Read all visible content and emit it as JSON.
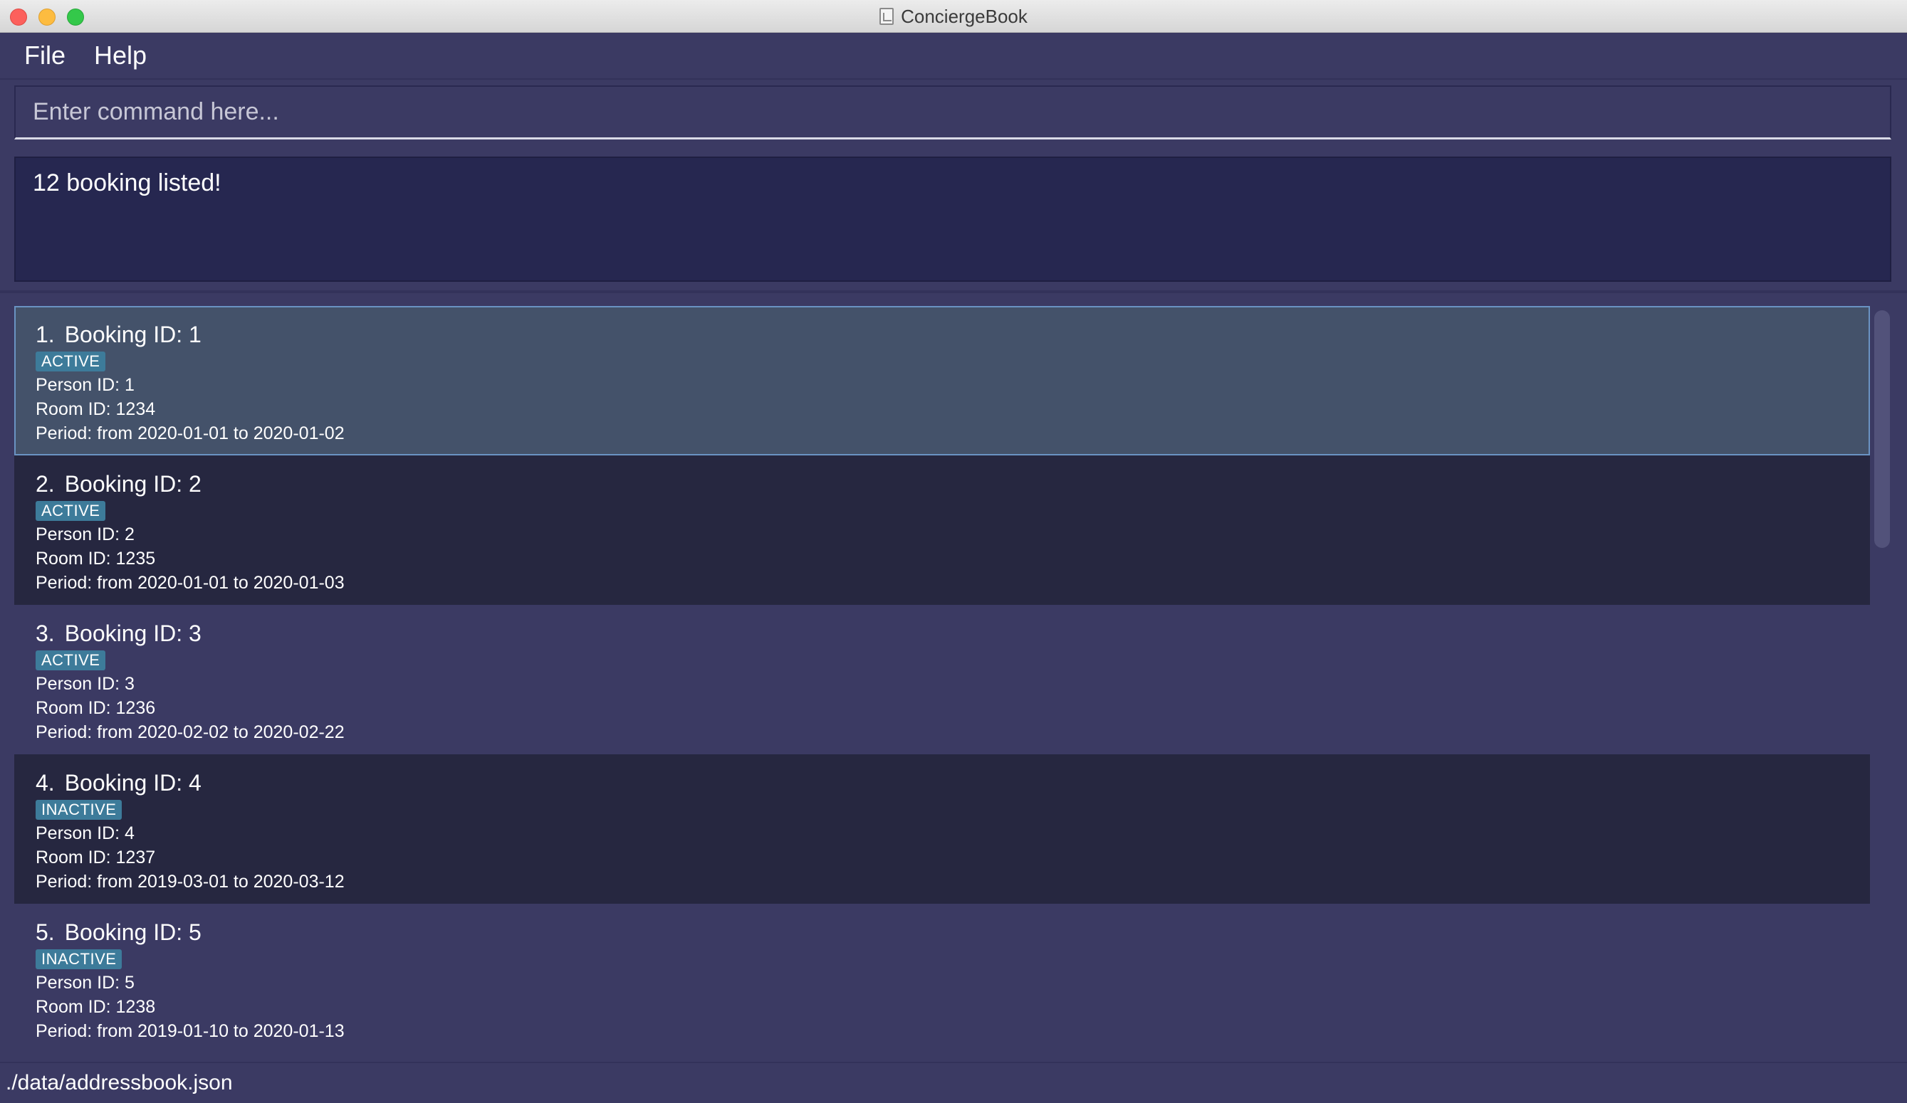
{
  "window": {
    "title": "ConciergeBook"
  },
  "menu": {
    "file": "File",
    "help": "Help"
  },
  "command": {
    "placeholder": "Enter command here..."
  },
  "result": {
    "message": "12 booking listed!"
  },
  "bookings": [
    {
      "index": "1.",
      "title": "Booking ID: 1",
      "status": "ACTIVE",
      "person": "Person ID: 1",
      "room": "Room ID: 1234",
      "period": "Period: from 2020-01-01 to 2020-01-02"
    },
    {
      "index": "2.",
      "title": "Booking ID: 2",
      "status": "ACTIVE",
      "person": "Person ID: 2",
      "room": "Room ID: 1235",
      "period": "Period: from 2020-01-01 to 2020-01-03"
    },
    {
      "index": "3.",
      "title": "Booking ID: 3",
      "status": "ACTIVE",
      "person": "Person ID: 3",
      "room": "Room ID: 1236",
      "period": "Period: from 2020-02-02 to 2020-02-22"
    },
    {
      "index": "4.",
      "title": "Booking ID: 4",
      "status": "INACTIVE",
      "person": "Person ID: 4",
      "room": "Room ID: 1237",
      "period": "Period: from 2019-03-01 to 2020-03-12"
    },
    {
      "index": "5.",
      "title": "Booking ID: 5",
      "status": "INACTIVE",
      "person": "Person ID: 5",
      "room": "Room ID: 1238",
      "period": "Period: from 2019-01-10 to 2020-01-13"
    }
  ],
  "status": {
    "file_path": "./data/addressbook.json"
  },
  "colors": {
    "background": "#3b3a63",
    "result_bg": "#262750",
    "selected_bg": "#44526a",
    "badge": "#3d7b9a"
  }
}
